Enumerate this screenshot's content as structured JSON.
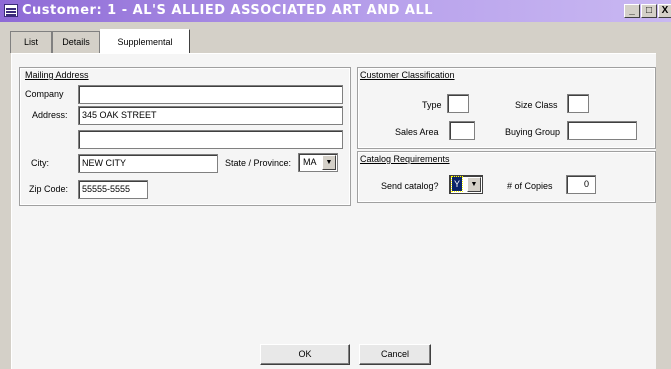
{
  "window": {
    "title": "Customer: 1 - AL'S ALLIED ASSOCIATED ART AND ALL",
    "minimize_label": "_",
    "maximize_label": "□",
    "close_label": "X"
  },
  "tabs": [
    {
      "label": "List",
      "active": false
    },
    {
      "label": "Details",
      "active": false
    },
    {
      "label": "Supplemental",
      "active": true
    }
  ],
  "mailing": {
    "title": "Mailing Address",
    "company_label": "Company",
    "company_value": "",
    "address_label": "Address:",
    "address_line1": "345 OAK STREET",
    "address_line2": "",
    "city_label": "City:",
    "city_value": "NEW CITY",
    "state_label": "State / Province:",
    "state_value": "MA",
    "zip_label": "Zip Code:",
    "zip_value": "55555-5555"
  },
  "classification": {
    "title": "Customer Classification",
    "type_label": "Type",
    "type_value": "",
    "size_class_label": "Size Class",
    "size_class_value": "",
    "sales_area_label": "Sales Area",
    "sales_area_value": "",
    "buying_group_label": "Buying Group",
    "buying_group_value": ""
  },
  "catalog": {
    "title": "Catalog Requirements",
    "send_label": "Send catalog?",
    "send_value": "Y",
    "copies_label": "# of Copies",
    "copies_value": "0"
  },
  "buttons": {
    "ok": "OK",
    "cancel": "Cancel"
  },
  "colors": {
    "titlebar_start": "#8e6ad6",
    "panel": "#f5f5f5",
    "selection": "#0a246a"
  }
}
